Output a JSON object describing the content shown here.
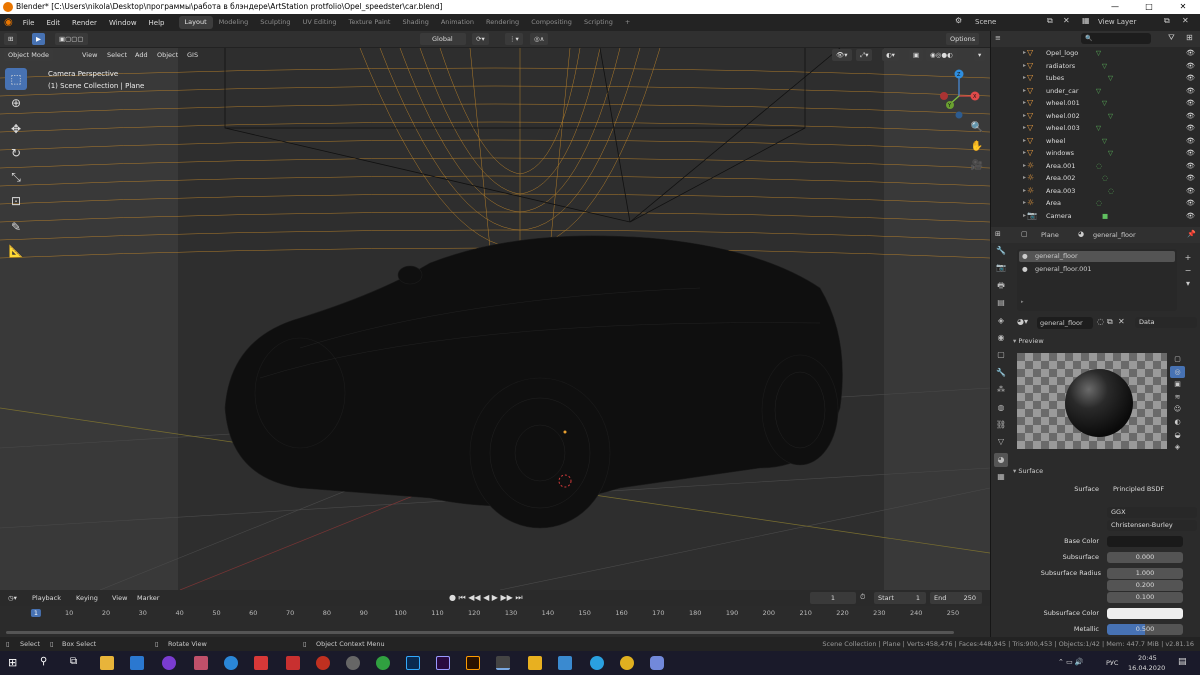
{
  "window": {
    "title": "Blender* [C:\\Users\\nikola\\Desktop\\программы\\работа в блэндере\\ArtStation protfolio\\Opel_speedster\\car.blend]",
    "min": "—",
    "max": "□",
    "close": "✕"
  },
  "menu": [
    "File",
    "Edit",
    "Render",
    "Window",
    "Help"
  ],
  "workspaces": [
    {
      "label": "Layout",
      "active": true
    },
    {
      "label": "Modeling",
      "active": false
    },
    {
      "label": "Sculpting",
      "active": false
    },
    {
      "label": "UV Editing",
      "active": false
    },
    {
      "label": "Texture Paint",
      "active": false
    },
    {
      "label": "Shading",
      "active": false
    },
    {
      "label": "Animation",
      "active": false
    },
    {
      "label": "Rendering",
      "active": false
    },
    {
      "label": "Compositing",
      "active": false
    },
    {
      "label": "Scripting",
      "active": false
    }
  ],
  "add_workspace": "+",
  "scene": {
    "label": "Scene",
    "view_layer": "View Layer"
  },
  "viewport": {
    "transform_orientation": "Global",
    "options": "Options",
    "mode": "Object Mode",
    "menus": [
      "View",
      "Select",
      "Add",
      "Object",
      "GIS"
    ],
    "overlay_title": "Camera Perspective",
    "overlay_subtitle": "(1) Scene Collection | Plane",
    "gizmo": {
      "x": "X",
      "y": "Y",
      "z": "Z"
    }
  },
  "outliner": {
    "items": [
      {
        "name": "Opel_logo",
        "arrow": "▸",
        "icon": "▽"
      },
      {
        "name": "radiators",
        "arrow": "▸",
        "icon": "▽"
      },
      {
        "name": "tubes",
        "arrow": "▸",
        "icon": "▽"
      },
      {
        "name": "under_car",
        "arrow": "▸",
        "icon": "▽"
      },
      {
        "name": "wheel.001",
        "arrow": "▸",
        "icon": "▽"
      },
      {
        "name": "wheel.002",
        "arrow": "▸",
        "icon": "▽"
      },
      {
        "name": "wheel.003",
        "arrow": "▸",
        "icon": "▽"
      },
      {
        "name": "wheel",
        "arrow": "▸",
        "icon": "▽"
      },
      {
        "name": "windows",
        "arrow": "▸",
        "icon": "▽"
      },
      {
        "name": "Area.001",
        "arrow": "▸",
        "icon": "◌"
      },
      {
        "name": "Area.002",
        "arrow": "▸",
        "icon": "◌"
      },
      {
        "name": "Area.003",
        "arrow": "▸",
        "icon": "◌"
      },
      {
        "name": "Area",
        "arrow": "▸",
        "icon": "◌"
      },
      {
        "name": "Camera",
        "arrow": "▸",
        "icon": "■"
      }
    ]
  },
  "properties": {
    "breadcrumb_object": "Plane",
    "breadcrumb_material": "general_floor",
    "slots": [
      "general_floor",
      "general_floor.001"
    ],
    "material_name": "general_floor",
    "link": "Data",
    "preview_panel": "Preview",
    "surface_panel": "Surface",
    "fields": {
      "surface_label": "Surface",
      "surface_value": "Principled BSDF",
      "distribution": "GGX",
      "subsurface_method": "Christensen-Burley",
      "base_color_label": "Base Color",
      "subsurface_label": "Subsurface",
      "subsurface_value": "0.000",
      "subsurface_radius_label": "Subsurface Radius",
      "radius": [
        "1.000",
        "0.200",
        "0.100"
      ],
      "subsurface_color_label": "Subsurface Color",
      "metallic_label": "Metallic",
      "metallic_value": "0.500"
    }
  },
  "timeline": {
    "menus": [
      "Playback",
      "Keying",
      "View",
      "Marker"
    ],
    "current_frame": "1",
    "start_label": "Start",
    "start": "1",
    "end_label": "End",
    "end": "250",
    "ticks": [
      "1",
      "10",
      "20",
      "30",
      "40",
      "50",
      "60",
      "70",
      "80",
      "90",
      "100",
      "110",
      "120",
      "130",
      "140",
      "150",
      "160",
      "170",
      "180",
      "190",
      "200",
      "210",
      "220",
      "230",
      "240",
      "250"
    ]
  },
  "statusbar": {
    "select": "Select",
    "box_select": "Box Select",
    "rotate_view": "Rotate View",
    "context_menu": "Object Context Menu",
    "stats": "Scene Collection | Plane | Verts:458,476 | Faces:448,945 | Tris:900,453 | Objects:1/42 | Mem: 447.7 MiB | v2.81.16"
  },
  "taskbar": {
    "lang": "РУС",
    "time": "20:45",
    "date": "16.04.2020"
  }
}
